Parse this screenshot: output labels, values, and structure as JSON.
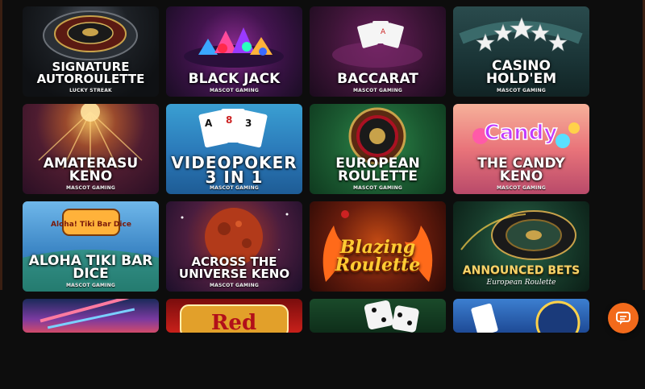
{
  "games": [
    {
      "title": "Signature\nAutoroulette",
      "provider": "LUCKY STREAK",
      "icon": "roulette-wheel-icon"
    },
    {
      "title": "Black Jack",
      "provider": "MASCOT GAMING",
      "icon": "gems-icon"
    },
    {
      "title": "Baccarat",
      "provider": "MASCOT GAMING",
      "icon": "cards-icon"
    },
    {
      "title": "Casino Hold'em",
      "provider": "MASCOT GAMING",
      "icon": "stars-icon"
    },
    {
      "title": "Amaterasu Keno",
      "provider": "MASCOT GAMING",
      "icon": "sun-rays-icon"
    },
    {
      "title": "VideoPoker\n3 in 1",
      "provider": "MASCOT GAMING",
      "icon": "playing-cards-icon"
    },
    {
      "title": "European\nRoulette",
      "provider": "MASCOT GAMING",
      "icon": "roulette-wheel-icon"
    },
    {
      "title": "The Candy\nKeno",
      "provider": "MASCOT GAMING",
      "logo_text": "Candy",
      "icon": "candy-logo-icon"
    },
    {
      "title": "Aloha Tiki Bar\nDice",
      "provider": "MASCOT GAMING",
      "logo_text": "Aloha! Tiki Bar Dice",
      "icon": "tiki-logo-icon"
    },
    {
      "title": "Across the\nUniverse Keno",
      "provider": "MASCOT GAMING",
      "icon": "planet-icon"
    },
    {
      "title": "Blazing\nRoulette",
      "provider": "",
      "icon": "flame-icon"
    },
    {
      "title": "Announced Bets",
      "subtitle": "European Roulette",
      "provider": "",
      "icon": "roulette-wheel-icon"
    }
  ],
  "partial_row": [
    {
      "label": "",
      "icon": "lights-icon"
    },
    {
      "label": "Red",
      "icon": "red-logo-icon"
    },
    {
      "label": "",
      "icon": "dice-icon"
    },
    {
      "label": "",
      "icon": "cards-icon"
    }
  ],
  "chat": {
    "icon": "chat-icon",
    "color": "#f26a1b"
  }
}
